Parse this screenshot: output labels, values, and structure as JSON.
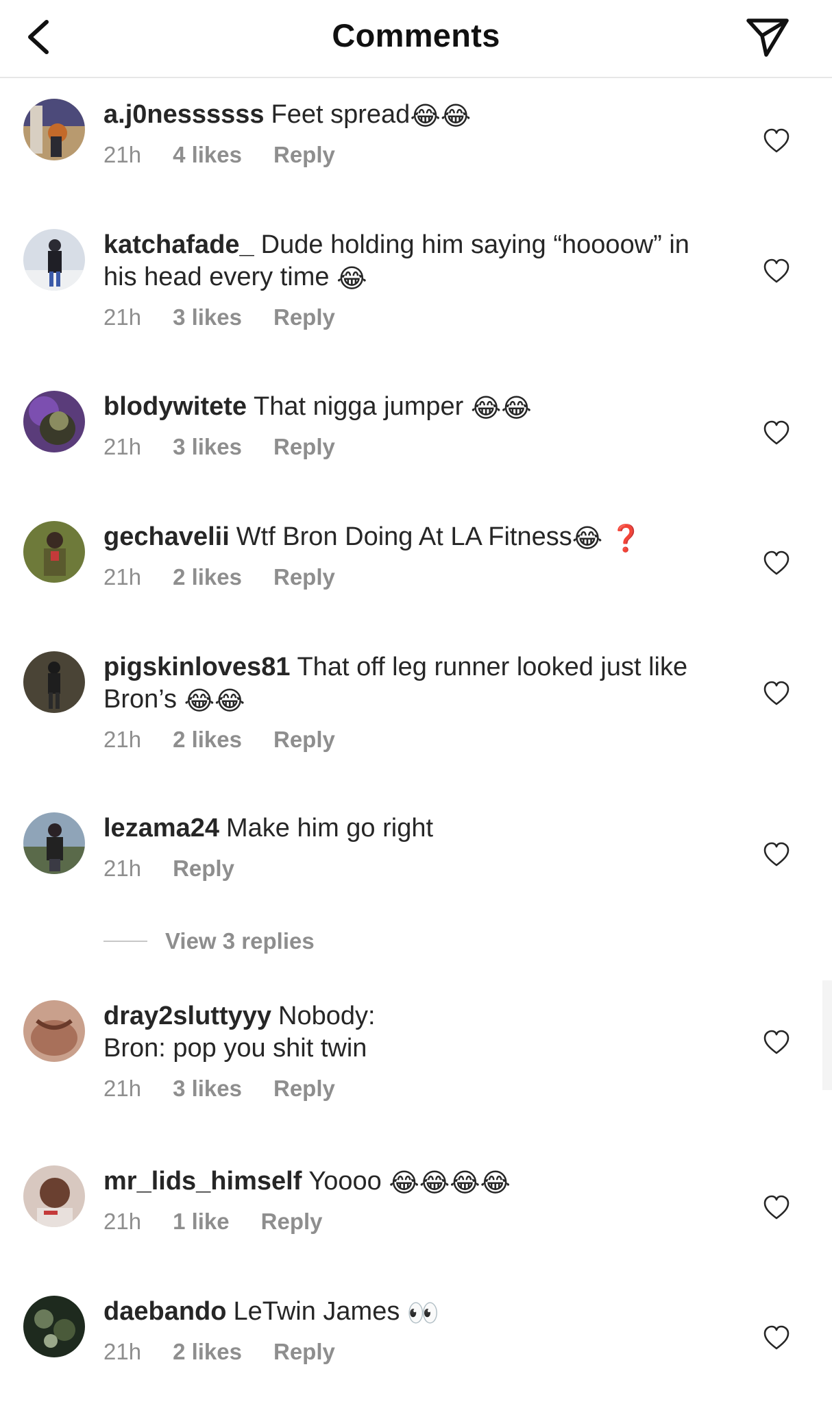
{
  "header": {
    "title": "Comments",
    "back_icon": "chevron-left-icon",
    "send_icon": "paper-plane-icon"
  },
  "comments": [
    {
      "username": "a.j0nessssss",
      "text": "Feet spread",
      "emoji": "😂😂",
      "time": "21h",
      "likes": "4 likes",
      "reply": "Reply"
    },
    {
      "username": "katchafade_",
      "text": "Dude holding him saying “hoooow” in his head every time",
      "emoji": "😂",
      "time": "21h",
      "likes": "3 likes",
      "reply": "Reply"
    },
    {
      "username": "blodywitete",
      "text": "That nigga jumper",
      "emoji": "😂😂",
      "time": "21h",
      "likes": "3 likes",
      "reply": "Reply"
    },
    {
      "username": "gechavelii",
      "text": "Wtf Bron Doing At LA Fitness",
      "emoji": "😂 ❓",
      "time": "21h",
      "likes": "2 likes",
      "reply": "Reply"
    },
    {
      "username": "pigskinloves81",
      "text": "That off leg runner looked just like Bron’s",
      "emoji": "😂😂",
      "time": "21h",
      "likes": "2 likes",
      "reply": "Reply"
    },
    {
      "username": "lezama24",
      "text": "Make him go right",
      "emoji": "",
      "time": "21h",
      "likes": "",
      "reply": "Reply"
    },
    {
      "username": "dray2sluttyyy",
      "text": "Nobody:",
      "text2": "Bron: pop you shit twin",
      "emoji": "",
      "time": "21h",
      "likes": "3 likes",
      "reply": "Reply"
    },
    {
      "username": "mr_lids_himself",
      "text": "Yoooo",
      "emoji": "😂😂😂😂",
      "time": "21h",
      "likes": "1 like",
      "reply": "Reply"
    },
    {
      "username": "daebando",
      "text": "LeTwin James",
      "emoji": "👀",
      "time": "21h",
      "likes": "2 likes",
      "reply": "Reply"
    }
  ],
  "view_replies": "View 3 replies",
  "colors": {
    "text": "#262626",
    "meta": "#8e8e8e",
    "divider": "#e6e6e6"
  }
}
